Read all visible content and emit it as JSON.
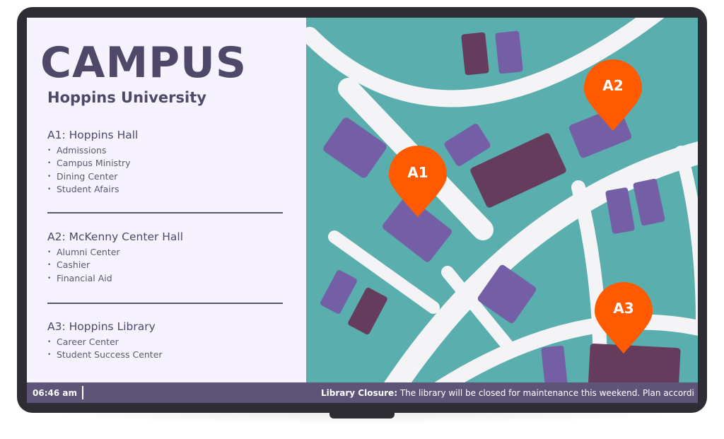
{
  "brand": {
    "title": "CAMPUS",
    "subtitle": "Hoppins University"
  },
  "sections": [
    {
      "heading": "A1: Hoppins Hall",
      "items": [
        "Admissions",
        "Campus Ministry",
        "Dining Center",
        "Student Afairs"
      ]
    },
    {
      "heading": "A2: McKenny Center Hall",
      "items": [
        "Alumni Center",
        "Cashier",
        "Financial Aid"
      ]
    },
    {
      "heading": "A3: Hoppins Library",
      "items": [
        "Career Center",
        "Student Success Center"
      ]
    }
  ],
  "map": {
    "pins": [
      "A1",
      "A2",
      "A3"
    ],
    "colors": {
      "water": "#5aaeae",
      "road": "#f4f4f6",
      "building_light": "#745fa7",
      "building_dark": "#653c5c",
      "pin": "#ff5a00"
    }
  },
  "status_bar": {
    "time": "06:46 am",
    "ticker_title": "Library Closure:",
    "ticker_text": " The library will be closed for maintenance this weekend. Plan accordi"
  }
}
